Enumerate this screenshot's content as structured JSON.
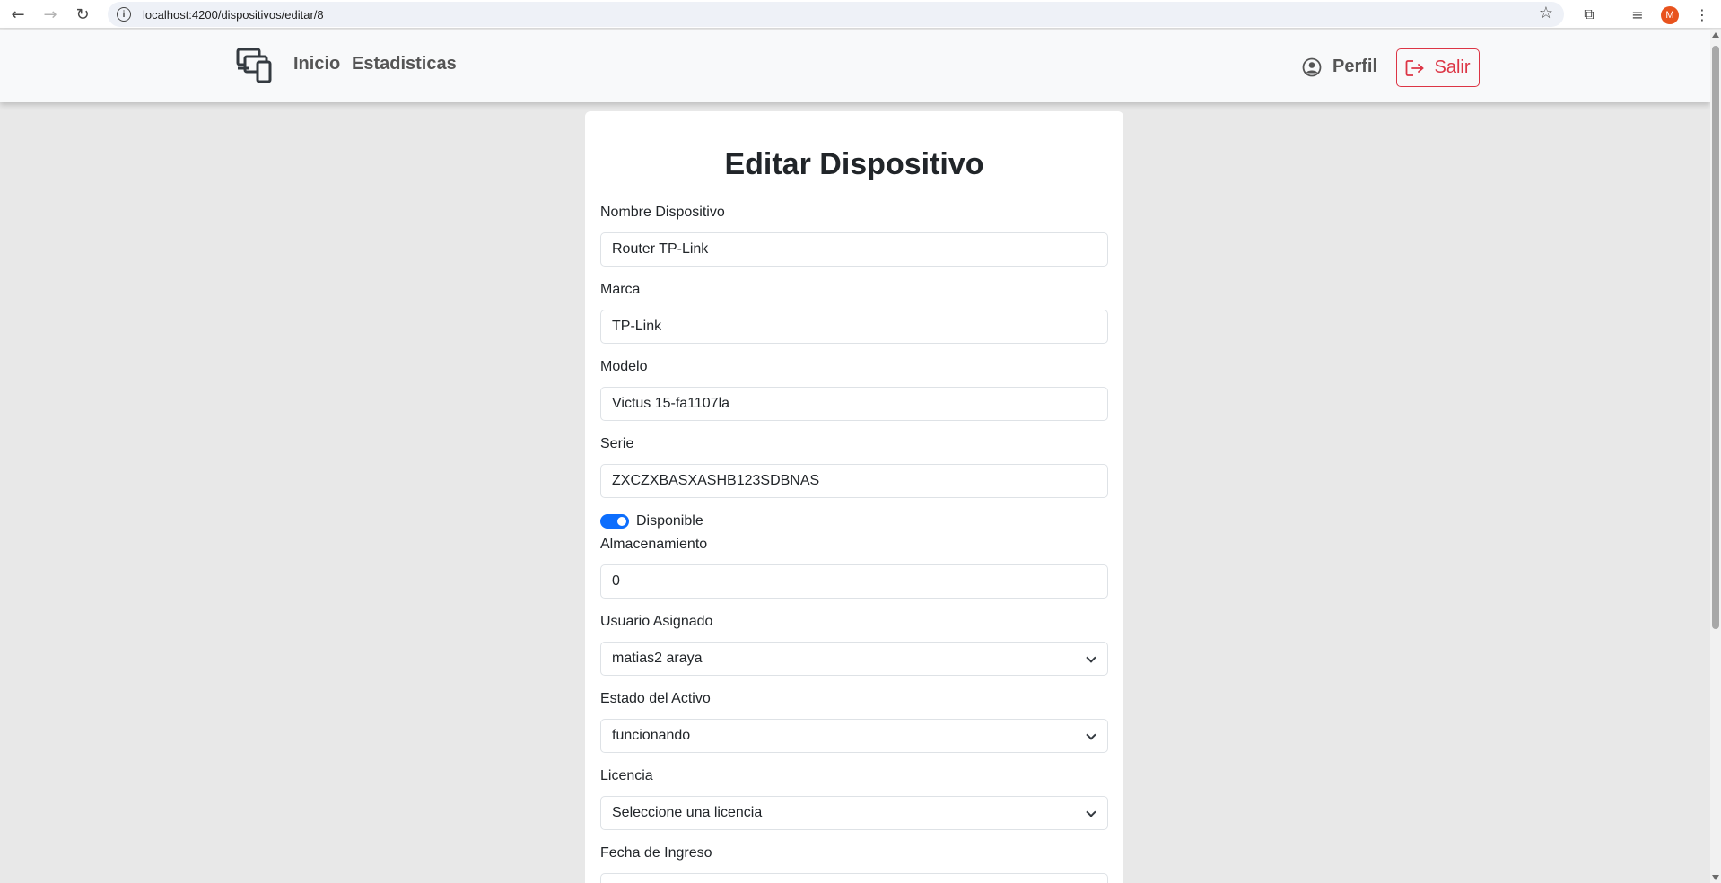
{
  "browser": {
    "url": "localhost:4200/dispositivos/editar/8",
    "profile_initial": "M"
  },
  "navbar": {
    "brand_icon": "devices-icon",
    "links": [
      "Inicio",
      "Estadisticas"
    ],
    "profile_label": "Perfil",
    "logout_label": "Salir",
    "logout_color": "#dc3545"
  },
  "form": {
    "title": "Editar Dispositivo",
    "nombre": {
      "label": "Nombre Dispositivo",
      "value": "Router TP-Link"
    },
    "marca": {
      "label": "Marca",
      "value": "TP-Link"
    },
    "modelo": {
      "label": "Modelo",
      "value": "Victus 15-fa1107la"
    },
    "serie": {
      "label": "Serie",
      "value": "ZXCZXBASXASHB123SDBNAS"
    },
    "disponible": {
      "label": "Disponible",
      "checked": true,
      "color": "#0d6efd"
    },
    "almacenamiento": {
      "label": "Almacenamiento",
      "value": "0"
    },
    "usuario": {
      "label": "Usuario Asignado",
      "value": "matias2 araya"
    },
    "estado": {
      "label": "Estado del Activo",
      "value": "funcionando"
    },
    "licencia": {
      "label": "Licencia",
      "value": "Seleccione una licencia"
    },
    "fecha": {
      "label": "Fecha de Ingreso",
      "value": ""
    }
  }
}
